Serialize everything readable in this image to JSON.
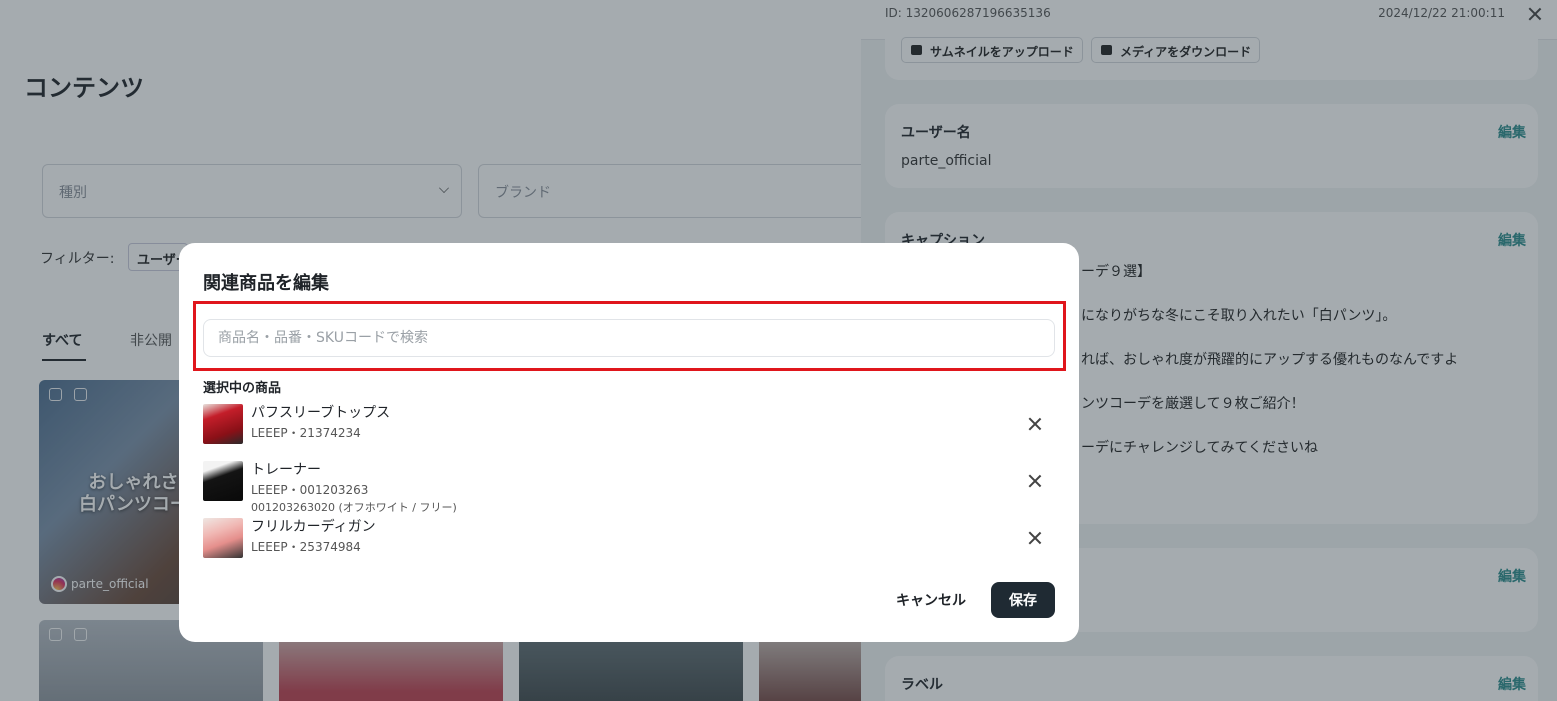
{
  "page": {
    "title": "コンテンツ",
    "type_select": "種別",
    "brand_select": "ブランド",
    "filter_label": "フィルター:",
    "filter_chip": "ユーザー",
    "tabs": [
      "すべて",
      "非公開"
    ],
    "card_text_line1": "おしゃれさ",
    "card_text_line2": "白パンツコー",
    "card_handle": "parte_official"
  },
  "drawer": {
    "id_text": "ID: 1320606287196635136",
    "date_text": "2024/12/22 21:00:11",
    "media_buttons": {
      "upload_thumbnail": "サムネイルをアップロード",
      "download_media": "メディアをダウンロード"
    },
    "sections": {
      "username": {
        "title": "ユーザー名",
        "edit": "編集",
        "value": "parte_official"
      },
      "caption": {
        "title": "キャプション",
        "edit": "編集",
        "lines": [
          "ーデ９選】",
          "になりがちな冬にこそ取り入れたい「白パンツ」。",
          "れば、おしゃれ度が飛躍的にアップする優れものなんですよ",
          "ンツコーデを厳選して９枚ご紹介！",
          "ーデにチャレンジしてみてくださいね"
        ]
      },
      "section4": {
        "edit": "編集"
      },
      "label": {
        "title": "ラベル",
        "edit": "編集"
      }
    }
  },
  "modal": {
    "title": "関連商品を編集",
    "search_placeholder": "商品名・品番・SKUコードで検索",
    "search_value": "",
    "selected_label": "選択中の商品",
    "products": [
      {
        "name": "パフスリーブトップス",
        "meta": "LEEEP・21374234",
        "variant": ""
      },
      {
        "name": "トレーナー",
        "meta": "LEEEP・001203263",
        "variant": "001203263020 (オフホワイト / フリー)"
      },
      {
        "name": "フリルカーディガン",
        "meta": "LEEEP・25374984",
        "variant": ""
      }
    ],
    "cancel_label": "キャンセル",
    "save_label": "保存"
  },
  "colors": {
    "highlight": "#e0161c",
    "accent_edit": "#2b8c8c",
    "save_button": "#1f2a33"
  }
}
